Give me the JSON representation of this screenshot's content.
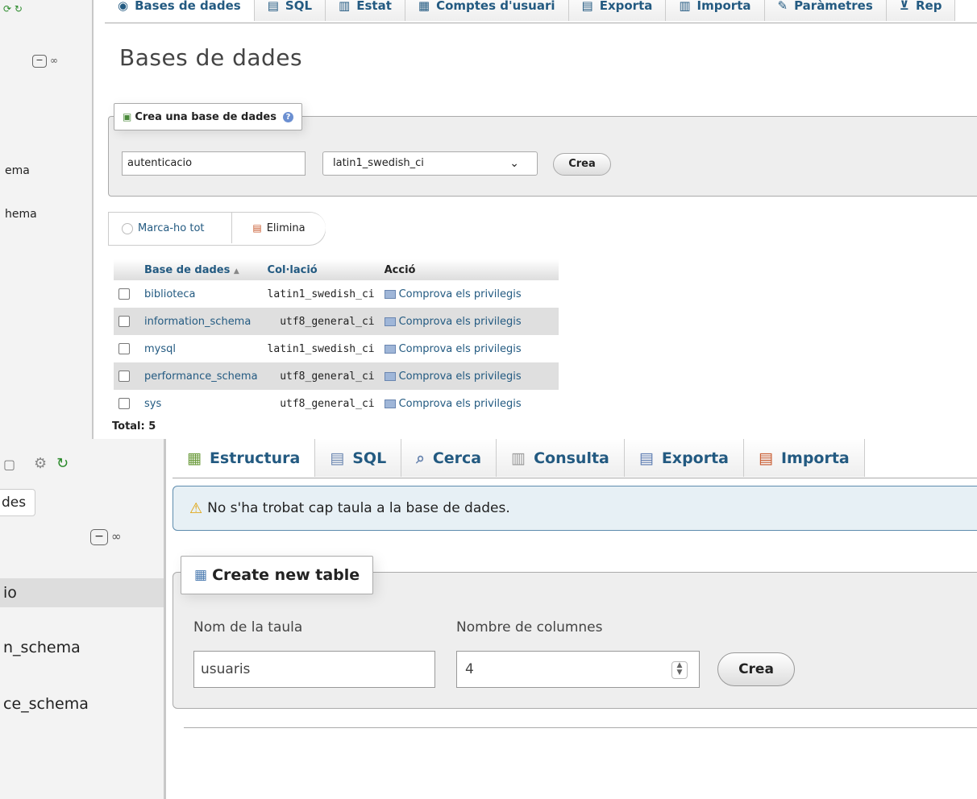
{
  "top": {
    "sidebar": {
      "items": [
        "ema",
        "hema"
      ]
    },
    "tabs": [
      {
        "label": "Bases de dades",
        "icon": "database-icon"
      },
      {
        "label": "SQL",
        "icon": "sql-icon"
      },
      {
        "label": "Estat",
        "icon": "status-icon"
      },
      {
        "label": "Comptes d'usuari",
        "icon": "users-icon"
      },
      {
        "label": "Exporta",
        "icon": "export-icon"
      },
      {
        "label": "Importa",
        "icon": "import-icon"
      },
      {
        "label": "Paràmetres",
        "icon": "settings-icon"
      },
      {
        "label": "Rep",
        "icon": "replication-icon"
      }
    ],
    "page_title": "Bases de dades",
    "create_db": {
      "legend": "Crea una base de dades",
      "name_value": "autenticacio",
      "collation_value": "latin1_swedish_ci",
      "button": "Crea"
    },
    "bulk": {
      "mark_all": "Marca-ho tot",
      "delete": "Elimina"
    },
    "table": {
      "headers": [
        "Base de dades",
        "Col·lació",
        "Acció"
      ],
      "rows": [
        {
          "name": "biblioteca",
          "collation": "latin1_swedish_ci",
          "action": "Comprova els privilegis"
        },
        {
          "name": "information_schema",
          "collation": "utf8_general_ci",
          "action": "Comprova els privilegis"
        },
        {
          "name": "mysql",
          "collation": "latin1_swedish_ci",
          "action": "Comprova els privilegis"
        },
        {
          "name": "performance_schema",
          "collation": "utf8_general_ci",
          "action": "Comprova els privilegis"
        },
        {
          "name": "sys",
          "collation": "utf8_general_ci",
          "action": "Comprova els privilegis"
        }
      ],
      "total": "Total: 5"
    }
  },
  "bottom": {
    "sidebar": {
      "tab_label": "des",
      "items": [
        "io",
        "n_schema",
        "ce_schema"
      ]
    },
    "tabs": [
      {
        "label": "Estructura",
        "icon": "structure-icon"
      },
      {
        "label": "SQL",
        "icon": "sql-icon"
      },
      {
        "label": "Cerca",
        "icon": "search-icon"
      },
      {
        "label": "Consulta",
        "icon": "query-icon"
      },
      {
        "label": "Exporta",
        "icon": "export-icon"
      },
      {
        "label": "Importa",
        "icon": "import-icon"
      }
    ],
    "notice": "No s'ha trobat cap taula a la base de dades.",
    "create_table": {
      "legend": "Create new table",
      "name_label": "Nom de la taula",
      "cols_label": "Nombre de columnes",
      "name_value": "usuaris",
      "cols_value": "4",
      "button": "Crea"
    }
  }
}
